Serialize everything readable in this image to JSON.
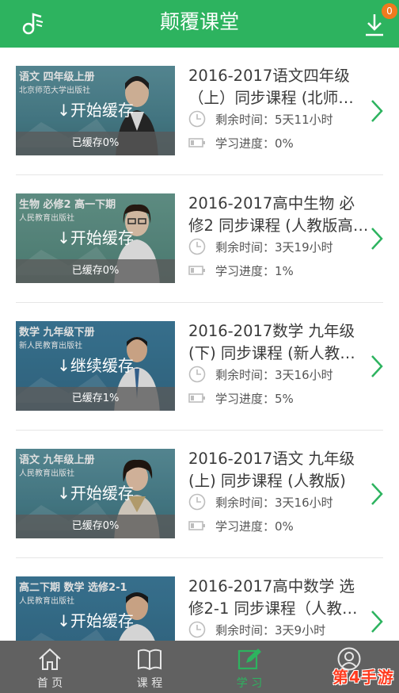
{
  "header": {
    "title": "颠覆课堂",
    "download_badge": "0"
  },
  "courses": [
    {
      "thumb_subject": "语文 四年级上册",
      "thumb_publisher": "北京师范大学出版社",
      "action": "↓开始缓存",
      "cached": "已缓存0%",
      "title_line1": "2016-2017语文四年级",
      "title_line2": "（上）同步课程 (北师…",
      "remaining": "剩余时间：5天11小时",
      "progress": "学习进度：0%"
    },
    {
      "thumb_subject": "生物 必修2  高一下期",
      "thumb_publisher": "人民教育出版社",
      "action": "↓开始缓存",
      "cached": "已缓存0%",
      "title_line1": "2016-2017高中生物 必",
      "title_line2": "修2 同步课程 (人教版高…",
      "remaining": "剩余时间：3天19小时",
      "progress": "学习进度：1%"
    },
    {
      "thumb_subject": "数学  九年级下册",
      "thumb_publisher": "新人民教育出版社",
      "action": "↓继续缓存",
      "cached": "已缓存1%",
      "title_line1": "2016-2017数学 九年级",
      "title_line2": "(下) 同步课程 (新人教…",
      "remaining": "剩余时间：3天16小时",
      "progress": "学习进度：5%"
    },
    {
      "thumb_subject": "语文  九年级上册",
      "thumb_publisher": "人民教育出版社",
      "action": "↓开始缓存",
      "cached": "已缓存0%",
      "title_line1": "2016-2017语文 九年级",
      "title_line2": "(上) 同步课程 (人教版)",
      "remaining": "剩余时间：3天16小时",
      "progress": "学习进度：0%"
    },
    {
      "thumb_subject": "高二下期  数学 选修2-1",
      "thumb_publisher": "人民教育出版社",
      "action": "↓开始缓存",
      "cached": "",
      "title_line1": "2016-2017高中数学 选",
      "title_line2": "修2-1 同步课程（人教…",
      "remaining": "剩余时间：3天9小时",
      "progress": ""
    }
  ],
  "tabs": [
    {
      "label": "首 页",
      "icon": "home-icon"
    },
    {
      "label": "课 程",
      "icon": "book-icon"
    },
    {
      "label": "学 习",
      "icon": "edit-icon"
    },
    {
      "label": "",
      "icon": "user-icon"
    }
  ],
  "watermark": "第4手游",
  "colors": {
    "brand_green": "#2db35f",
    "tabbar": "#616161",
    "badge": "#f07a1e"
  }
}
